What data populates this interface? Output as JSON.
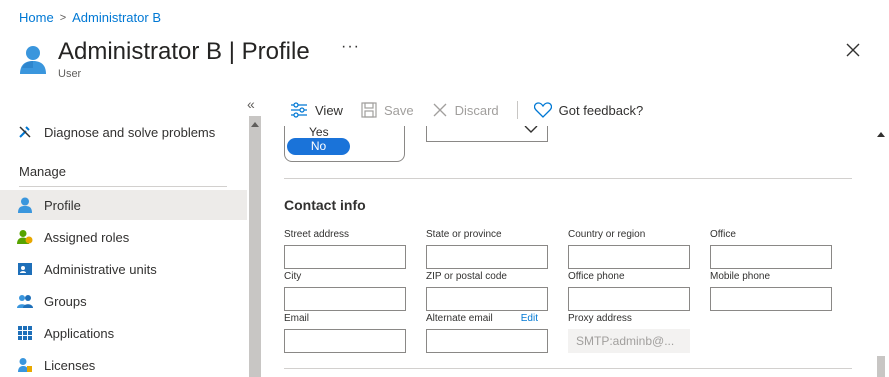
{
  "breadcrumb": {
    "home": "Home",
    "current": "Administrator B",
    "separator": ">"
  },
  "header": {
    "title_name": "Administrator B",
    "title_sep": " | ",
    "title_page": "Profile",
    "subtitle": "User",
    "more": "···",
    "icon": "user-icon"
  },
  "collapse_label": "«",
  "sidebar": {
    "items": [
      {
        "label": "Diagnose and solve problems",
        "icon": "wrench-icon"
      }
    ],
    "section_manage": "Manage",
    "manage_items": [
      {
        "label": "Profile",
        "icon": "person-icon",
        "active": true
      },
      {
        "label": "Assigned roles",
        "icon": "roles-icon"
      },
      {
        "label": "Administrative units",
        "icon": "admin-units-icon"
      },
      {
        "label": "Groups",
        "icon": "groups-icon"
      },
      {
        "label": "Applications",
        "icon": "grid-icon"
      },
      {
        "label": "Licenses",
        "icon": "license-icon"
      }
    ]
  },
  "toolbar": {
    "view": "View",
    "save": "Save",
    "discard": "Discard",
    "feedback": "Got feedback?"
  },
  "toggle": {
    "yes": "Yes",
    "no": "No",
    "selected": "No"
  },
  "contact": {
    "title": "Contact info",
    "fields": [
      {
        "label": "Street address",
        "value": ""
      },
      {
        "label": "State or province",
        "value": ""
      },
      {
        "label": "Country or region",
        "value": ""
      },
      {
        "label": "Office",
        "value": ""
      },
      {
        "label": "City",
        "value": ""
      },
      {
        "label": "ZIP or postal code",
        "value": ""
      },
      {
        "label": "Office phone",
        "value": ""
      },
      {
        "label": "Mobile phone",
        "value": ""
      },
      {
        "label": "Email",
        "value": ""
      },
      {
        "label": "Alternate email",
        "value": "",
        "action": "Edit"
      },
      {
        "label": "Proxy address",
        "value": "SMTP:adminb@..."
      }
    ]
  },
  "colors": {
    "accent": "#0078d4",
    "toggle_selected": "#1a73d9",
    "active_bg": "#edebe9"
  }
}
